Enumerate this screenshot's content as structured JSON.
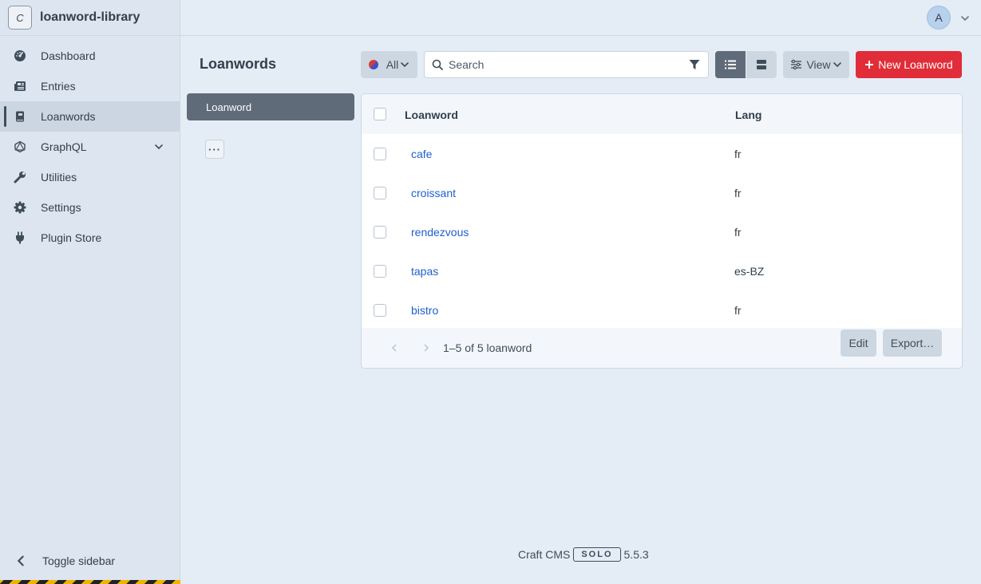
{
  "site": {
    "icon_letter": "C",
    "name": "loanword-library"
  },
  "nav": {
    "items": [
      {
        "label": "Dashboard",
        "icon": "gauge-icon"
      },
      {
        "label": "Entries",
        "icon": "newspaper-icon"
      },
      {
        "label": "Loanwords",
        "icon": "book-icon",
        "active": true
      },
      {
        "label": "GraphQL",
        "icon": "graphql-icon",
        "has_submenu": true
      },
      {
        "label": "Utilities",
        "icon": "wrench-icon"
      },
      {
        "label": "Settings",
        "icon": "gear-icon"
      },
      {
        "label": "Plugin Store",
        "icon": "plug-icon"
      }
    ],
    "toggle_label": "Toggle sidebar"
  },
  "user": {
    "avatar_letter": "A"
  },
  "page": {
    "title": "Loanwords"
  },
  "toolbar": {
    "site_label": "All",
    "search_placeholder": "Search",
    "view_label": "View",
    "new_label": "New Loanword"
  },
  "sources": {
    "items": [
      "Loanword"
    ]
  },
  "table": {
    "columns": [
      "Loanword",
      "Lang"
    ],
    "rows": [
      {
        "title": "cafe",
        "lang": "fr"
      },
      {
        "title": "croissant",
        "lang": "fr"
      },
      {
        "title": "rendezvous",
        "lang": "fr"
      },
      {
        "title": "tapas",
        "lang": "es-BZ"
      },
      {
        "title": "bistro",
        "lang": "fr"
      }
    ],
    "pagination": "1–5 of 5 loanword",
    "edit_label": "Edit",
    "export_label": "Export…"
  },
  "footer": {
    "product": "Craft CMS",
    "edition": "SOLO",
    "version": "5.5.3"
  },
  "colors": {
    "accent": "#e12d39",
    "link": "#1f5fcf",
    "sidebar_bg": "#dce5f0",
    "page_bg": "#e4ecf6"
  }
}
